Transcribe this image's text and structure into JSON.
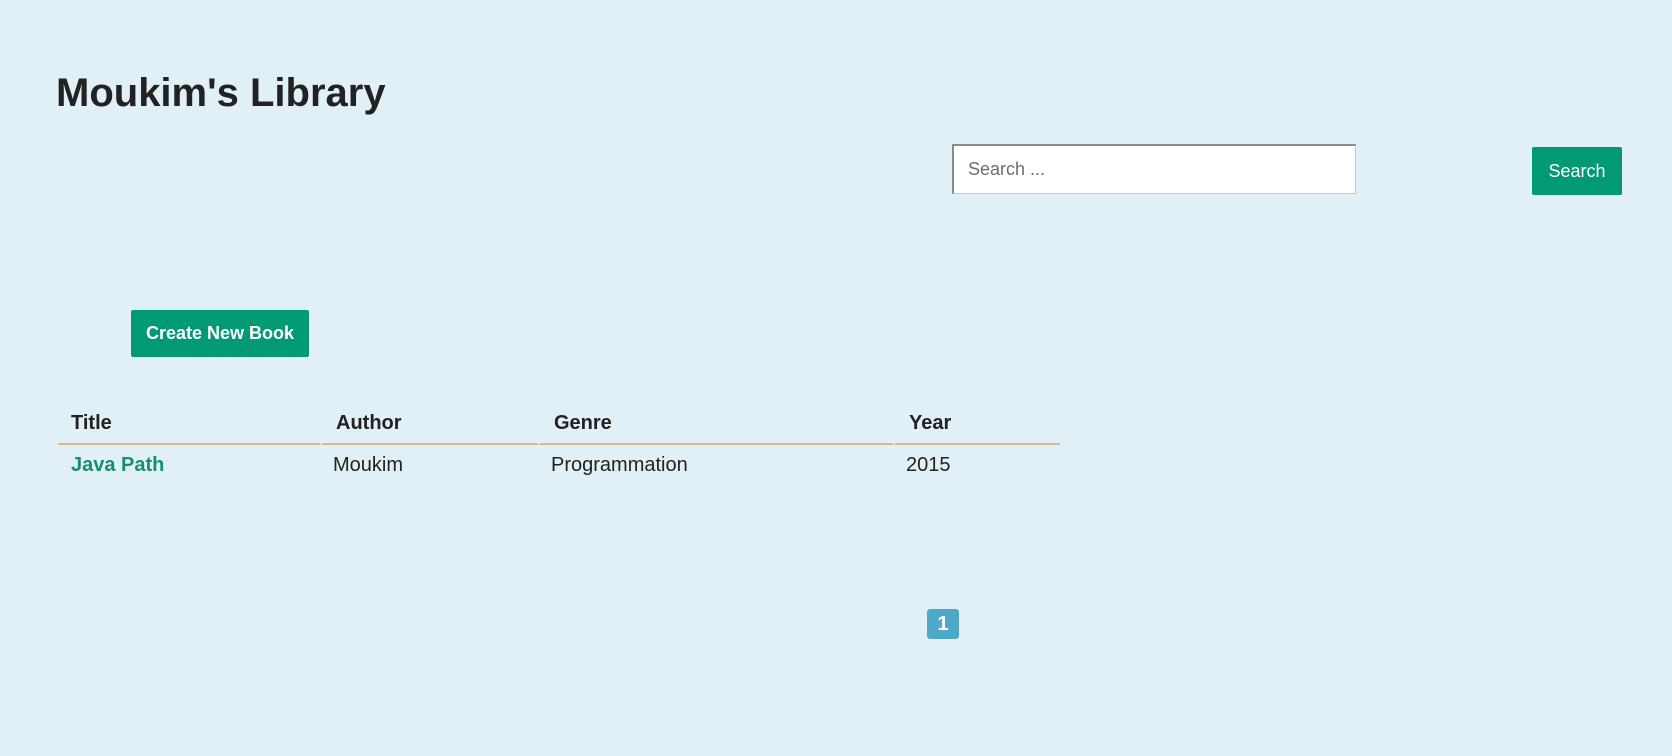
{
  "header": {
    "title": "Moukim's Library"
  },
  "search": {
    "placeholder": "Search ...",
    "value": "",
    "button_label": "Search"
  },
  "actions": {
    "create_label": "Create New Book"
  },
  "table": {
    "columns": [
      "Title",
      "Author",
      "Genre",
      "Year"
    ],
    "rows": [
      {
        "title": "Java Path",
        "author": "Moukim",
        "genre": "Programmation",
        "year": "2015"
      }
    ]
  },
  "pagination": {
    "pages": [
      "1"
    ],
    "current": "1"
  },
  "colors": {
    "background": "#e1f0f6",
    "accent": "#029a74",
    "link": "#16906c",
    "header_border": "#dfb98a",
    "page_active": "#4ea9c8"
  }
}
